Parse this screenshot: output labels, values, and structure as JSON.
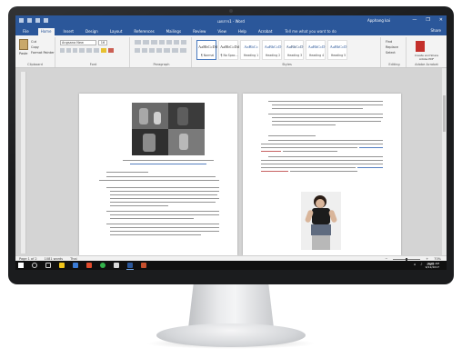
{
  "window": {
    "title": "เอกสาร1 - Word",
    "user": "Apphang kai",
    "minimize": "—",
    "restore": "❐",
    "close": "✕"
  },
  "tabs": [
    {
      "label": "File"
    },
    {
      "label": "Home"
    },
    {
      "label": "Insert"
    },
    {
      "label": "Design"
    },
    {
      "label": "Layout"
    },
    {
      "label": "References"
    },
    {
      "label": "Mailings"
    },
    {
      "label": "Review"
    },
    {
      "label": "View"
    },
    {
      "label": "Help"
    },
    {
      "label": "Acrobat"
    }
  ],
  "tell_me": "Tell me what you want to do",
  "share": "Share",
  "ribbon": {
    "clipboard": {
      "label": "Clipboard",
      "paste": "Paste",
      "cut": "Cut",
      "copy": "Copy",
      "format_painter": "Format Painter"
    },
    "font": {
      "label": "Font",
      "name": "Angsana New",
      "size": "16"
    },
    "paragraph": {
      "label": "Paragraph"
    },
    "styles": {
      "label": "Styles",
      "items": [
        {
          "sample": "AaBbCcDd",
          "name": "¶ Normal"
        },
        {
          "sample": "AaBbCcDd",
          "name": "¶ No Spac..."
        },
        {
          "sample": "AaBbCc",
          "name": "Heading 1"
        },
        {
          "sample": "AaBbCcD",
          "name": "Heading 2"
        },
        {
          "sample": "AaBbCcD",
          "name": "Heading 3"
        },
        {
          "sample": "AaBbCcD",
          "name": "Heading 4"
        },
        {
          "sample": "AaBbCcD",
          "name": "Heading 5"
        }
      ]
    },
    "editing": {
      "label": "Editing",
      "find": "Find",
      "replace": "Replace",
      "select": "Select"
    },
    "adobe": {
      "label": "Adobe Acrobat",
      "create": "Create and Share Adobe PDF"
    }
  },
  "status": {
    "page": "Page 1 of 2",
    "words": "1081 words",
    "language": "Thai",
    "zoom": "70%"
  },
  "taskbar": {
    "lang": "ENG",
    "time": "9:06 AM",
    "date": "9/12/2017"
  }
}
